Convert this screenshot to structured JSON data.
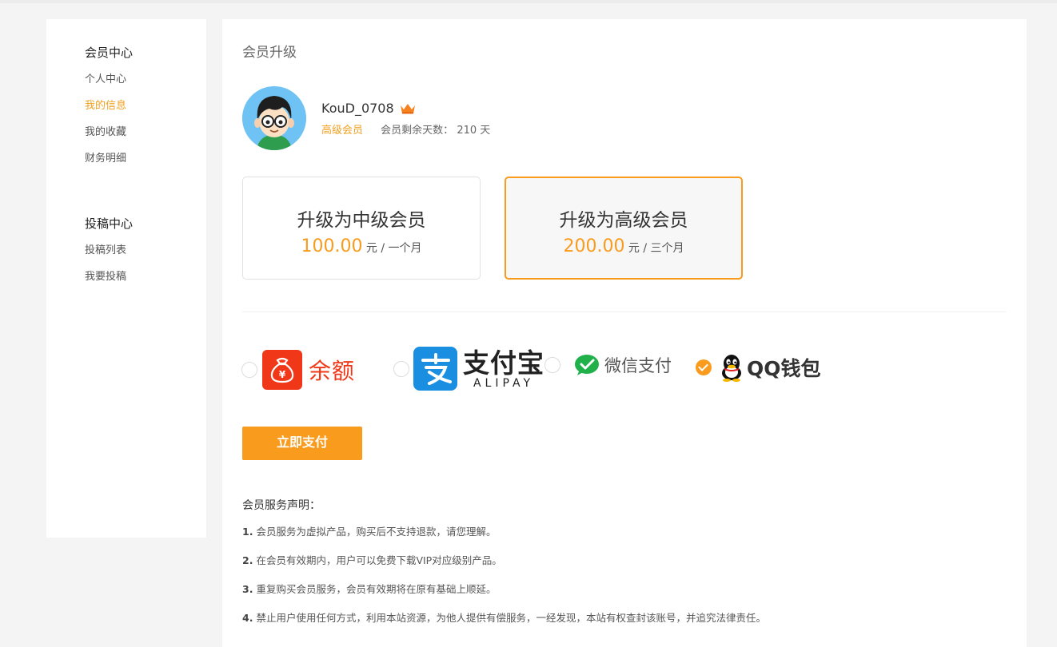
{
  "sidebar": {
    "groups": [
      {
        "title": "会员中心",
        "items": [
          {
            "label": "个人中心",
            "active": false
          },
          {
            "label": "我的信息",
            "active": true
          },
          {
            "label": "我的收藏",
            "active": false
          },
          {
            "label": "财务明细",
            "active": false
          }
        ]
      },
      {
        "title": "投稿中心",
        "items": [
          {
            "label": "投稿列表",
            "active": false
          },
          {
            "label": "我要投稿",
            "active": false
          }
        ]
      }
    ]
  },
  "main": {
    "title": "会员升级",
    "user": {
      "name": "KouD_0708",
      "level": "高级会员",
      "days_label": "会员剩余天数：",
      "days_value": "210 天"
    },
    "plans": [
      {
        "name": "升级为中级会员",
        "amount": "100.00",
        "unit": "元 / 一个月",
        "selected": false
      },
      {
        "name": "升级为高级会员",
        "amount": "200.00",
        "unit": "元 / 三个月",
        "selected": true
      }
    ],
    "payment_methods": [
      {
        "id": "balance",
        "label": "余额",
        "icon": "money-bag-icon",
        "checked": false
      },
      {
        "id": "alipay",
        "label": "支付宝",
        "sublabel": "ALIPAY",
        "icon": "alipay-icon",
        "checked": false
      },
      {
        "id": "wechat",
        "label": "微信支付",
        "icon": "wechat-icon",
        "checked": false
      },
      {
        "id": "qq",
        "label": "QQ钱包",
        "icon": "qq-penguin-icon",
        "checked": true
      }
    ],
    "pay_button": "立即支付",
    "notice": {
      "title": "会员服务声明：",
      "items": [
        {
          "num": "1.",
          "text": "会员服务为虚拟产品，购买后不支持退款，请您理解。"
        },
        {
          "num": "2.",
          "text": "在会员有效期内，用户可以免费下载VIP对应级别产品。"
        },
        {
          "num": "3.",
          "text": "重复购买会员服务，会员有效期将在原有基础上顺延。"
        },
        {
          "num": "4.",
          "text": "禁止用户使用任何方式，利用本站资源，为他人提供有偿服务，一经发现，本站有权查封该账号，并追究法律责任。"
        }
      ]
    }
  },
  "colors": {
    "accent": "#f99b1c",
    "active_text": "#f0a020",
    "balance_red": "#f03818",
    "alipay_blue": "#1a8ee0",
    "wechat_green": "#21b14b"
  }
}
